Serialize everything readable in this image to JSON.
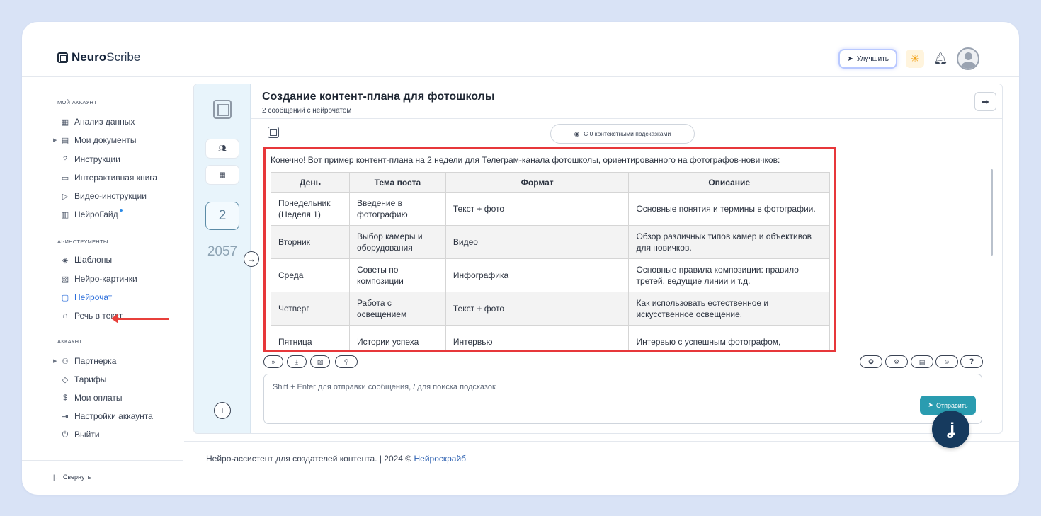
{
  "app": {
    "logo_bold": "Neuro",
    "logo_light": "Scribe"
  },
  "header": {
    "upgrade_label": "Улучшить",
    "upgrade_icon": "rocket-icon",
    "theme_icon": "sun-icon",
    "bell_icon": "bell-icon"
  },
  "sidebar": {
    "section_account": "МОЙ АККАУНТ",
    "section_ai": "AI-ИНСТРУМЕНТЫ",
    "section_acc": "АККАУНТ",
    "items": [
      {
        "label": "Анализ данных",
        "icon": "grid-icon"
      },
      {
        "label": "Мои документы",
        "icon": "document-icon"
      },
      {
        "label": "Инструкции",
        "icon": "help-icon"
      },
      {
        "label": "Интерактивная книга",
        "icon": "book-icon"
      },
      {
        "label": "Видео-инструкции",
        "icon": "video-icon"
      },
      {
        "label": "НейроГайд",
        "icon": "layout-icon"
      },
      {
        "label": "Шаблоны",
        "icon": "layers-icon"
      },
      {
        "label": "Нейро-картинки",
        "icon": "image-icon"
      },
      {
        "label": "Нейрочат",
        "icon": "chat-icon"
      },
      {
        "label": "Речь в текст",
        "icon": "headphones-icon"
      },
      {
        "label": "Партнерка",
        "icon": "users-icon"
      },
      {
        "label": "Тарифы",
        "icon": "tag-icon"
      },
      {
        "label": "Мои оплаты",
        "icon": "dollar-icon"
      },
      {
        "label": "Настройки аккаунта",
        "icon": "login-icon"
      },
      {
        "label": "Выйти",
        "icon": "power-icon"
      }
    ],
    "collapse_label": "Свернуть"
  },
  "rail": {
    "current_count": "2",
    "total": "2057"
  },
  "chat": {
    "title": "Создание контент-плана для фотошколы",
    "subtitle": "2 сообщений с нейрочатом",
    "hints_label": "С 0 контекстными подсказками",
    "intro": "Конечно! Вот пример контент-плана на 2 недели для Телеграм-канала фотошколы, ориентированного на фотографов-новичков:",
    "table_headers": [
      "День",
      "Тема поста",
      "Формат",
      "Описание"
    ],
    "table_rows": [
      [
        "Понедельник (Неделя 1)",
        "Введение в фотографию",
        "Текст + фото",
        "Основные понятия и термины в фотографии."
      ],
      [
        "Вторник",
        "Выбор камеры и оборудования",
        "Видео",
        "Обзор различных типов камер и объективов для новичков."
      ],
      [
        "Среда",
        "Советы по композиции",
        "Инфографика",
        "Основные правила композиции: правило третей, ведущие линии и т.д."
      ],
      [
        "Четверг",
        "Работа с освещением",
        "Текст + фото",
        "Как использовать естественное и искусственное освещение."
      ],
      [
        "Пятница",
        "Истории успеха",
        "Интервью",
        "Интервью с успешным фотографом,"
      ]
    ],
    "composer_placeholder": "Shift + Enter для отправки сообщения, / для поиска подсказок",
    "send_label": "Отправить"
  },
  "footer": {
    "text": "Нейро-ассистент для создателей контента.  | 2024 © ",
    "link": "Нейроскрайб"
  },
  "colors": {
    "accent": "#2b6edb",
    "send": "#2a9cb0",
    "highlight": "#e7373a",
    "fab": "#163a5e"
  }
}
